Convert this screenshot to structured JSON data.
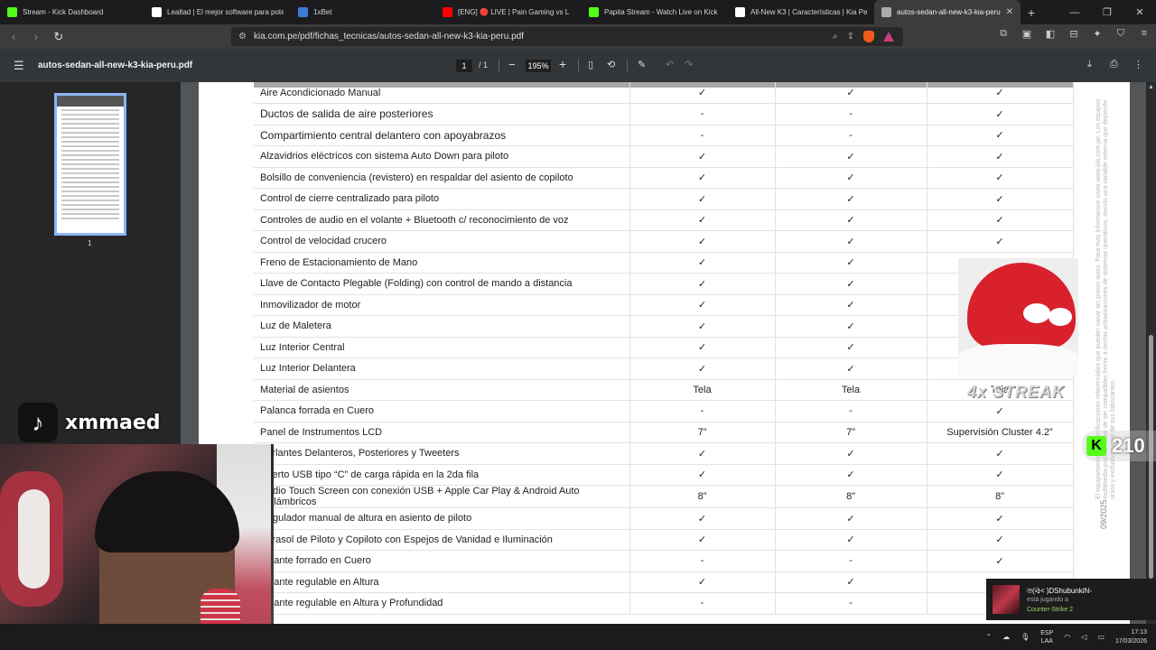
{
  "tabs": [
    {
      "title": "Stream - Kick Dashboard",
      "icon": "kick-icon",
      "color": "#53fc18",
      "width": 160
    },
    {
      "title": "Lealtad | El mejor software para pote",
      "icon": "diamond-icon",
      "color": "#ffffff",
      "width": 162
    },
    {
      "title": "1xBet",
      "icon": "1xbet-icon",
      "color": "#3f7cd8",
      "width": 160
    },
    {
      "title": "[ENG] 🔴 LIVE | Pain Gaming vs L",
      "icon": "youtube-icon",
      "color": "#ff0000",
      "width": 162
    },
    {
      "title": "Papita Stream - Watch Live on Kick",
      "icon": "kick-icon",
      "color": "#53fc18",
      "width": 162
    },
    {
      "title": "All-New K3 | Características | Kia Pe",
      "icon": "kia-icon",
      "color": "#ffffff",
      "width": 162
    },
    {
      "title": "autos-sedan-all-new-k3-kia-peru",
      "icon": "globe-icon",
      "color": "#aaaaaa",
      "width": 162,
      "active": true
    }
  ],
  "address": {
    "url": "kia.com.pe/pdf/fichas_tecnicas/autos-sedan-all-new-k3-kia-peru.pdf"
  },
  "pdf": {
    "filename": "autos-sedan-all-new-k3-kia-peru.pdf",
    "page_current": "1",
    "page_total": "/ 1",
    "zoom": "195%",
    "thumb_page": "1",
    "side_note": "El equipamiento y especificaciones referenciales que pueden variar sin previo aviso. Para más información visita www.kia.com.pe. Los equipos multimedia podrían dejar de ser compatibles frente a ciertas actualizaciones de sistemas operativos, siendo una variable externa que depende única y exclusivamente de sus fabricantes.",
    "date": "09/2025"
  },
  "table": {
    "rows": [
      {
        "feature": "Aire Acondicionado Manual",
        "v1": "✓",
        "v2": "✓",
        "v3": "✓"
      },
      {
        "feature": "Ductos de salida de aire posteriores",
        "v1": "-",
        "v2": "-",
        "v3": "✓",
        "large": true
      },
      {
        "feature": "Compartimiento central delantero con apoyabrazos",
        "v1": "-",
        "v2": "-",
        "v3": "✓",
        "large": true
      },
      {
        "feature": "Alzavidrios eléctricos con sistema Auto Down para piloto",
        "v1": "✓",
        "v2": "✓",
        "v3": "✓"
      },
      {
        "feature": "Bolsillo de conveniencia (revistero) en respaldar del asiento de copiloto",
        "v1": "✓",
        "v2": "✓",
        "v3": "✓"
      },
      {
        "feature": "Control de cierre centralizado para piloto",
        "v1": "✓",
        "v2": "✓",
        "v3": "✓"
      },
      {
        "feature": "Controles de audio en el volante + Bluetooth c/ reconocimiento de voz",
        "v1": "✓",
        "v2": "✓",
        "v3": "✓"
      },
      {
        "feature": "Control de velocidad crucero",
        "v1": "✓",
        "v2": "✓",
        "v3": "✓"
      },
      {
        "feature": "Freno de Estacionamiento de Mano",
        "v1": "✓",
        "v2": "✓",
        "v3": ""
      },
      {
        "feature": "Llave de Contacto Plegable (Folding) con control de mando a distancia",
        "v1": "✓",
        "v2": "✓",
        "v3": ""
      },
      {
        "feature": "Inmovilizador de motor",
        "v1": "✓",
        "v2": "✓",
        "v3": ""
      },
      {
        "feature": "Luz de Maletera",
        "v1": "✓",
        "v2": "✓",
        "v3": ""
      },
      {
        "feature": "Luz Interior Central",
        "v1": "✓",
        "v2": "✓",
        "v3": ""
      },
      {
        "feature": "Luz Interior Delantera",
        "v1": "✓",
        "v2": "✓",
        "v3": ""
      },
      {
        "feature": "Material de asientos",
        "v1": "Tela",
        "v2": "Tela",
        "v3": "Tela"
      },
      {
        "feature": "Palanca forrada en Cuero",
        "v1": "-",
        "v2": "-",
        "v3": "✓"
      },
      {
        "feature": "Panel de Instrumentos LCD",
        "v1": "7”",
        "v2": "7”",
        "v3": "Supervisión Cluster 4.2”"
      },
      {
        "feature": "Parlantes Delanteros, Posteriores y Tweeters",
        "v1": "✓",
        "v2": "✓",
        "v3": "✓"
      },
      {
        "feature": "Puerto USB tipo “C” de carga rápida en la 2da fila",
        "v1": "✓",
        "v2": "✓",
        "v3": "✓"
      },
      {
        "feature": "Radio Touch Screen con conexión USB + Apple Car Play & Android Auto Inalámbricos",
        "v1": "8”",
        "v2": "8”",
        "v3": "8”"
      },
      {
        "feature": "Regulador manual de altura en asiento de piloto",
        "v1": "✓",
        "v2": "✓",
        "v3": "✓"
      },
      {
        "feature": "Parasol de Piloto y Copiloto con Espejos de Vanidad e Iluminación",
        "v1": "✓",
        "v2": "✓",
        "v3": "✓"
      },
      {
        "feature": "Volante forrado en Cuero",
        "v1": "-",
        "v2": "-",
        "v3": "✓"
      },
      {
        "feature": "Volante regulable en Altura",
        "v1": "✓",
        "v2": "✓",
        "v3": ""
      },
      {
        "feature": "Volante regulable en Altura y Profundidad",
        "v1": "-",
        "v2": "-",
        "v3": ""
      }
    ]
  },
  "overlays": {
    "tiktok_name": "xmmaed",
    "streak": "4x STREAK",
    "kick_count": "210",
    "notif_user": "ত(ᐛ< )DShubunkiN-",
    "notif_status": "está jugando a",
    "notif_game": "Counter-Strike 2"
  },
  "taskbar": {
    "lang1": "ESP",
    "lang2": "LAA",
    "time": "17:13",
    "date": "17/03/2026"
  }
}
